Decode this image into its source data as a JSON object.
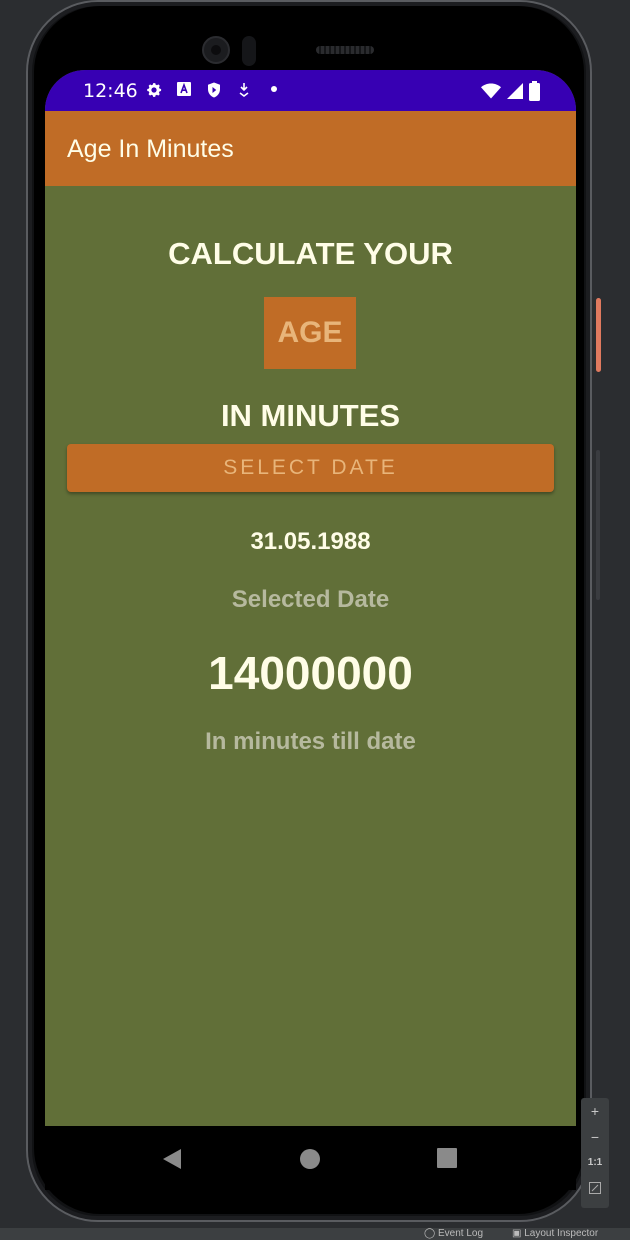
{
  "status_bar": {
    "time": "12:46",
    "icons": [
      "gear-icon",
      "text-a-icon",
      "shield-icon",
      "download-icon",
      "dot-icon"
    ],
    "right_icons": [
      "wifi-icon",
      "cell-signal-icon",
      "battery-icon"
    ]
  },
  "app_bar": {
    "title": "Age In Minutes"
  },
  "main": {
    "heading_top": "CALCULATE YOUR",
    "age_label": "AGE",
    "heading_bottom": "IN MINUTES",
    "select_button": "SELECT DATE",
    "selected_date_value": "31.05.1988",
    "selected_date_caption": "Selected Date",
    "minutes_value": "14000000",
    "minutes_caption": "In minutes till date"
  },
  "nav_bar": {
    "buttons": [
      "back-icon",
      "home-icon",
      "recents-icon"
    ]
  },
  "emulator_toolbar": {
    "zoom_in": "+",
    "zoom_out": "−",
    "actual_size": "1:1"
  },
  "ide_status": {
    "event_log": "Event Log",
    "layout_inspector": "Layout Inspector"
  },
  "colors": {
    "status_bar": "#3700b3",
    "app_bar": "#c06c26",
    "background": "#616f38",
    "text_primary": "#fffde7",
    "text_secondary": "#b6b99e",
    "accent_text": "#e8b57a"
  }
}
